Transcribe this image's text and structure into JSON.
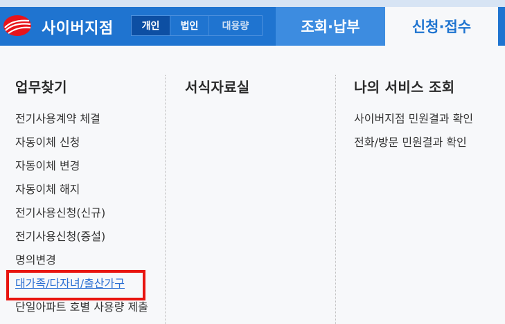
{
  "header": {
    "brand": "사이버지점",
    "segments": [
      "개인",
      "법인",
      "대용량"
    ],
    "active_segment": "개인",
    "menu": [
      {
        "label": "조회·납부",
        "active": false
      },
      {
        "label": "신청·접수",
        "active": true
      }
    ],
    "colors": {
      "primary": "#1f74d0",
      "active_text": "#1f74d0"
    }
  },
  "columns": [
    {
      "title": "업무찾기",
      "items": [
        "전기사용계약 체결",
        "자동이체 신청",
        "자동이체 변경",
        "자동이체 해지",
        "전기사용신청(신규)",
        "전기사용신청(증설)",
        "명의변경",
        "대가족/다자녀/출산가구",
        "단일아파트 호별 사용량 제출"
      ],
      "highlighted_item": "대가족/다자녀/출산가구"
    },
    {
      "title": "서식자료실",
      "items": []
    },
    {
      "title": "나의 서비스 조회",
      "items": [
        "사이버지점 민원결과 확인",
        "전화/방문 민원결과 확인"
      ]
    }
  ],
  "highlight_color": "#e8140f"
}
